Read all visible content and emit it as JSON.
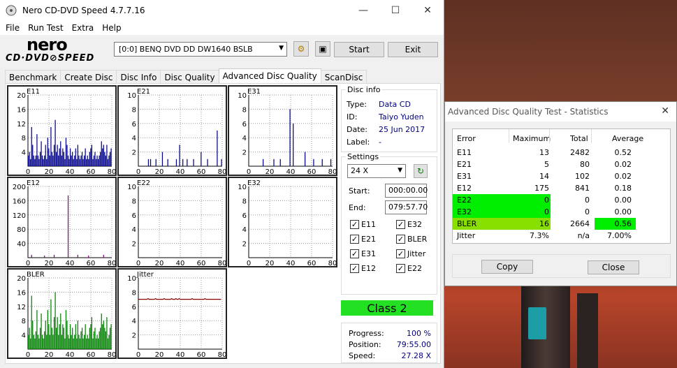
{
  "window": {
    "title": "Nero CD-DVD Speed 4.7.7.16",
    "minimize": "—",
    "maximize": "☐",
    "close": "✕"
  },
  "menu": [
    "File",
    "Run Test",
    "Extra",
    "Help"
  ],
  "logo": {
    "line1": "nero",
    "line2": "CD·DVD⊘SPEED"
  },
  "toolbar": {
    "drive": "[0:0]   BENQ DVD DD DW1640 BSLB",
    "start_label": "Start",
    "exit_label": "Exit"
  },
  "tabs": [
    "Benchmark",
    "Create Disc",
    "Disc Info",
    "Disc Quality",
    "Advanced Disc Quality",
    "ScanDisc"
  ],
  "active_tab": "Advanced Disc Quality",
  "graphs": [
    {
      "name": "E11",
      "yticks": [
        "20",
        "16",
        "12",
        "8",
        "4"
      ],
      "xticks": [
        "0",
        "20",
        "40",
        "60",
        "80"
      ],
      "color": "#00008b",
      "ymax": 20,
      "values": [
        3,
        4,
        2,
        11,
        6,
        3,
        2,
        3,
        9,
        3,
        2,
        4,
        7,
        3,
        2,
        3,
        6,
        2,
        8,
        5,
        3,
        11,
        4,
        3,
        6,
        13,
        4,
        6,
        3,
        5,
        7,
        3,
        5,
        4,
        2,
        8,
        6,
        3,
        2,
        5,
        3,
        4,
        2,
        3,
        5,
        2,
        6,
        3,
        2,
        3,
        4,
        2,
        3,
        5,
        2,
        3,
        2,
        4,
        5,
        6,
        2,
        3,
        4,
        2,
        3,
        2,
        3,
        4,
        7,
        5,
        6,
        4,
        3,
        6,
        2,
        3,
        4,
        5
      ]
    },
    {
      "name": "E21",
      "yticks": [
        "10",
        "8",
        "6",
        "4",
        "2"
      ],
      "xticks": [
        "0",
        "20",
        "40",
        "60",
        "80"
      ],
      "color": "#00008b",
      "ymax": 10,
      "values": [
        0,
        0,
        0,
        0,
        0,
        0,
        0,
        0,
        0,
        1,
        0,
        1,
        0,
        0,
        0,
        0,
        1,
        0,
        0,
        0,
        0,
        0,
        2,
        0,
        0,
        0,
        0,
        1,
        0,
        0,
        0,
        0,
        0,
        0,
        0,
        1,
        0,
        0,
        3,
        0,
        0,
        1,
        0,
        0,
        0,
        1,
        0,
        0,
        0,
        0,
        0,
        1,
        0,
        0,
        0,
        0,
        0,
        0,
        2,
        0,
        0,
        0,
        0,
        0,
        1,
        0,
        0,
        0,
        0,
        0,
        0,
        0,
        0,
        5,
        0,
        0,
        0,
        1
      ]
    },
    {
      "name": "E31",
      "yticks": [
        "10",
        "8",
        "6",
        "4",
        "2"
      ],
      "xticks": [
        "0",
        "20",
        "40",
        "60",
        "80"
      ],
      "color": "#00008b",
      "ymax": 10,
      "values": [
        0,
        0,
        0,
        0,
        0,
        0,
        0,
        0,
        0,
        0,
        0,
        0,
        0,
        1,
        0,
        0,
        0,
        0,
        0,
        0,
        0,
        0,
        0,
        1,
        0,
        0,
        0,
        0,
        0,
        1,
        0,
        0,
        0,
        0,
        0,
        0,
        0,
        0,
        8,
        0,
        0,
        6,
        0,
        0,
        0,
        0,
        0,
        0,
        0,
        0,
        0,
        0,
        2,
        0,
        0,
        0,
        0,
        0,
        0,
        0,
        1,
        0,
        0,
        0,
        0,
        0,
        0,
        0,
        1,
        0,
        0,
        0,
        0,
        0,
        0,
        0,
        1,
        0
      ]
    },
    {
      "name": "E12",
      "yticks": [
        "200",
        "160",
        "120",
        "80",
        "40"
      ],
      "xticks": [
        "0",
        "20",
        "40",
        "60",
        "80"
      ],
      "color": "#8b008b",
      "ymax": 200,
      "values": [
        0,
        0,
        0,
        8,
        0,
        0,
        0,
        0,
        0,
        0,
        0,
        0,
        0,
        0,
        0,
        6,
        0,
        0,
        0,
        0,
        0,
        0,
        0,
        0,
        8,
        0,
        0,
        0,
        0,
        0,
        0,
        0,
        0,
        0,
        0,
        0,
        0,
        175,
        0,
        0,
        0,
        0,
        0,
        0,
        0,
        0,
        8,
        0,
        0,
        0,
        0,
        0,
        0,
        0,
        0,
        0,
        6,
        0,
        0,
        0,
        0,
        0,
        0,
        0,
        0,
        0,
        0,
        0,
        0,
        0,
        8,
        0,
        0,
        0,
        0,
        0,
        0,
        0
      ]
    },
    {
      "name": "E22",
      "yticks": [
        "10",
        "8",
        "6",
        "4",
        "2"
      ],
      "xticks": [
        "0",
        "20",
        "40",
        "60",
        "80"
      ],
      "color": "#00008b",
      "ymax": 10,
      "values": []
    },
    {
      "name": "E32",
      "yticks": [
        "10",
        "8",
        "6",
        "4",
        "2"
      ],
      "xticks": [
        "0",
        "20",
        "40",
        "60",
        "80"
      ],
      "color": "#00008b",
      "ymax": 10,
      "values": []
    },
    {
      "name": "BLER",
      "yticks": [
        "20",
        "16",
        "12",
        "8",
        "4"
      ],
      "xticks": [
        "0",
        "20",
        "40",
        "60",
        "80"
      ],
      "color": "#008000",
      "ymax": 20,
      "values": [
        4,
        6,
        3,
        15,
        8,
        4,
        3,
        5,
        11,
        4,
        3,
        6,
        10,
        4,
        3,
        5,
        8,
        4,
        11,
        7,
        4,
        14,
        6,
        4,
        9,
        16,
        6,
        9,
        4,
        7,
        10,
        4,
        7,
        6,
        3,
        11,
        8,
        4,
        3,
        7,
        4,
        6,
        3,
        4,
        7,
        3,
        8,
        4,
        3,
        5,
        6,
        3,
        4,
        7,
        3,
        4,
        3,
        6,
        7,
        9,
        3,
        5,
        6,
        3,
        4,
        3,
        5,
        6,
        10,
        7,
        8,
        6,
        5,
        9,
        3,
        4,
        6,
        7
      ]
    },
    {
      "name": "Jitter",
      "yticks": [
        "10",
        "8",
        "6",
        "4",
        "2"
      ],
      "xticks": [
        "0",
        "20",
        "40",
        "60",
        "80"
      ],
      "color": "#8b0000",
      "ymax": 10,
      "values": [
        7.0,
        7.0,
        7.0,
        7.0,
        7.0,
        7.0,
        7.0,
        7.0,
        7.0,
        7.1,
        7.0,
        7.0,
        7.0,
        7.0,
        7.0,
        7.0,
        7.1,
        7.0,
        7.0,
        7.0,
        7.0,
        7.0,
        7.0,
        7.0,
        7.1,
        7.0,
        7.0,
        7.0,
        7.0,
        7.0,
        7.0,
        7.1,
        7.0,
        7.0,
        7.0,
        7.1,
        7.0,
        7.0,
        7.1,
        7.0,
        7.0,
        7.0,
        7.0,
        7.0,
        7.0,
        7.0,
        7.0,
        7.0,
        7.0,
        7.0,
        7.1,
        7.0,
        7.0,
        7.0,
        7.0,
        7.0,
        7.0,
        7.0,
        7.0,
        7.0,
        7.0,
        7.0,
        7.1,
        7.0,
        7.0,
        7.0,
        7.0,
        7.0,
        7.0,
        7.0,
        7.0,
        7.0,
        7.0,
        7.0,
        7.0,
        7.0,
        7.0,
        7.0
      ]
    }
  ],
  "disc_info": {
    "title": "Disc info",
    "type_label": "Type:",
    "type_value": "Data CD",
    "id_label": "ID:",
    "id_value": "Taiyo Yuden",
    "date_label": "Date:",
    "date_value": "25 Jun 2017",
    "label_label": "Label:",
    "label_value": "-"
  },
  "settings": {
    "title": "Settings",
    "speed": "24 X",
    "start_label": "Start:",
    "start_value": "000:00.00",
    "end_label": "End:",
    "end_value": "079:57.70",
    "checks": [
      {
        "label": "E11",
        "checked": "✓"
      },
      {
        "label": "E32",
        "checked": "✓"
      },
      {
        "label": "E21",
        "checked": "✓"
      },
      {
        "label": "BLER",
        "checked": "✓"
      },
      {
        "label": "E31",
        "checked": "✓"
      },
      {
        "label": "Jitter",
        "checked": "✓"
      },
      {
        "label": "E12",
        "checked": "✓"
      },
      {
        "label": "E22",
        "checked": "✓"
      }
    ]
  },
  "class_label": "Class 2",
  "progress": {
    "progress_label": "Progress:",
    "progress_value": "100 %",
    "position_label": "Position:",
    "position_value": "79:55.00",
    "speed_label": "Speed:",
    "speed_value": "27.28 X"
  },
  "stats": {
    "title": "Advanced Disc Quality Test - Statistics",
    "close": "✕",
    "headers": [
      "Error",
      "Maximum",
      "Total",
      "Average"
    ],
    "rows": [
      [
        "E11",
        "13",
        "2482",
        "0.52"
      ],
      [
        "E21",
        "5",
        "80",
        "0.02"
      ],
      [
        "E31",
        "14",
        "102",
        "0.02"
      ],
      [
        "E12",
        "175",
        "841",
        "0.18"
      ],
      [
        "E22",
        "0",
        "0",
        "0.00"
      ],
      [
        "E32",
        "0",
        "0",
        "0.00"
      ],
      [
        "BLER",
        "16",
        "2664",
        "0.56"
      ],
      [
        "Jitter",
        "7.3%",
        "n/a",
        "7.00%"
      ]
    ],
    "copy_label": "Copy",
    "close_label": "Close"
  }
}
